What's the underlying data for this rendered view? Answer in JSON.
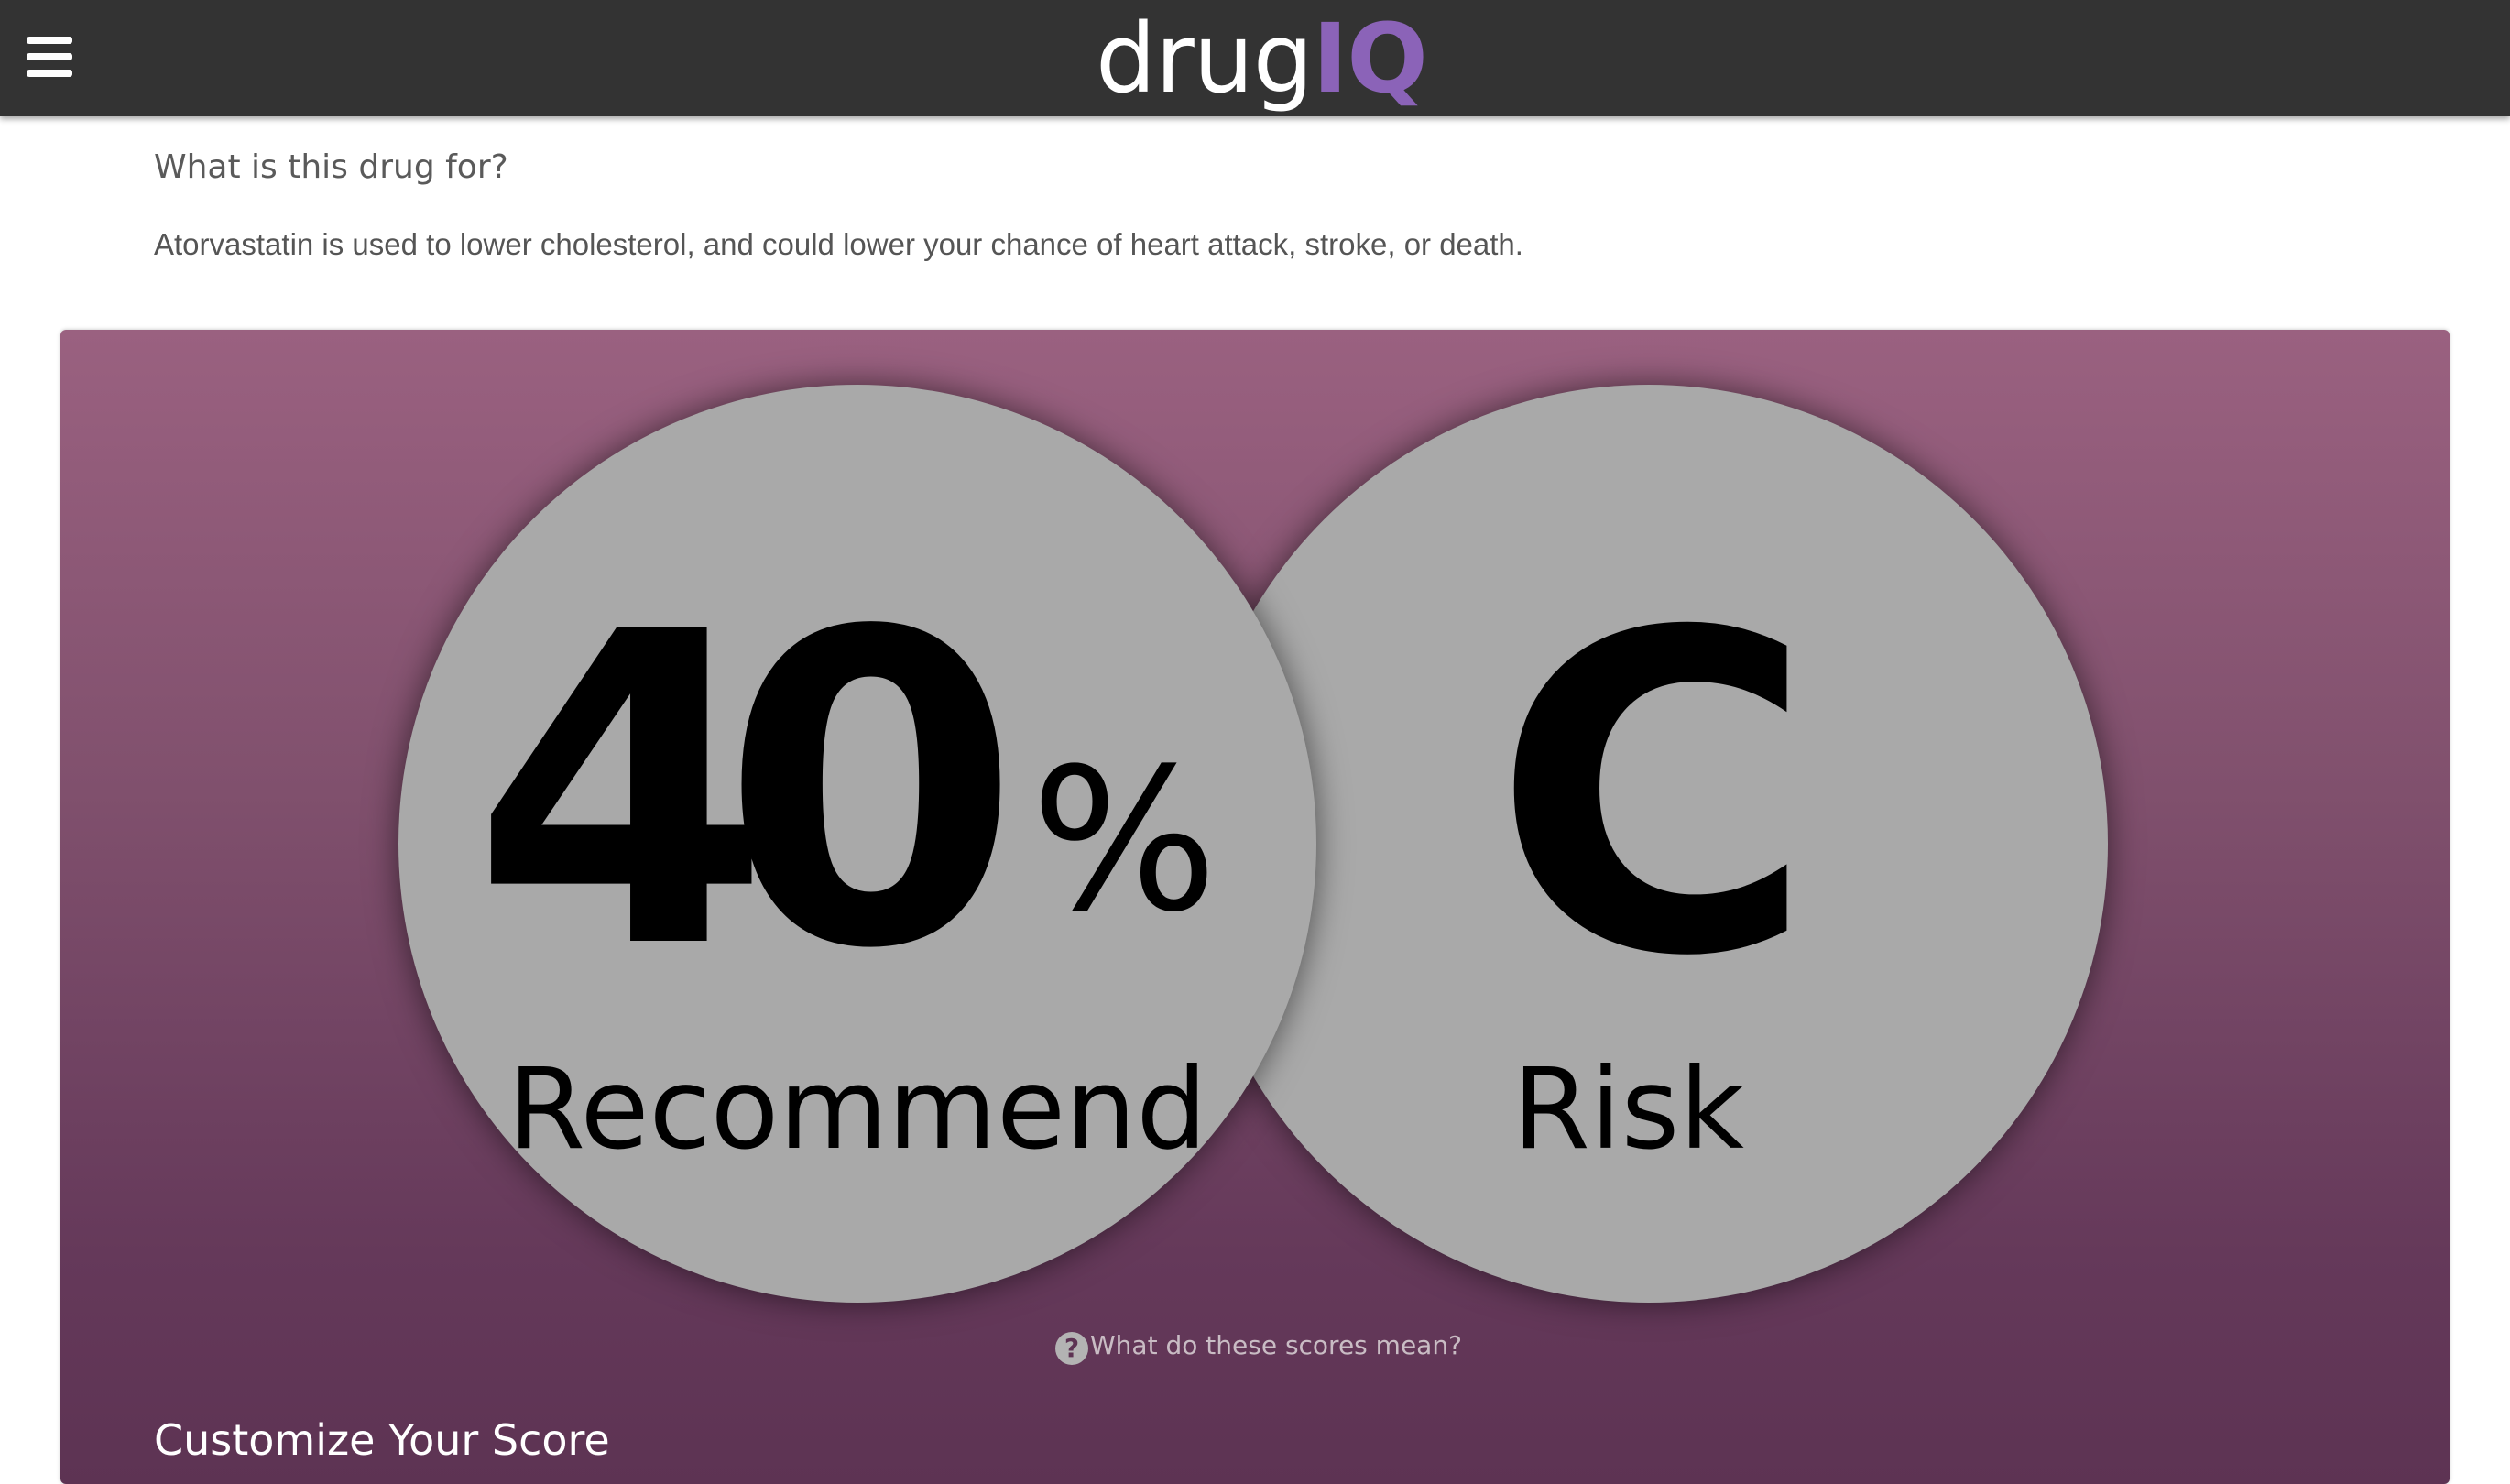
{
  "header": {
    "menu_icon": "hamburger-menu-icon",
    "logo": {
      "part1": "drug",
      "part2": "IQ"
    },
    "background_color": "#333333",
    "logo_accent_color": "#8b63b8"
  },
  "drug_info": {
    "question": "What is this drug for?",
    "answer": "Atorvastatin is used to lower cholesterol, and could lower your chance of heart attack, stroke, or death."
  },
  "scores": {
    "recommend": {
      "value": "40",
      "unit": "%",
      "label": "Recommend"
    },
    "risk": {
      "value": "C",
      "label": "Risk"
    },
    "help_icon": "question-circle-icon",
    "help_text": "What do these scores mean?",
    "panel_colors": {
      "top": "#9a6180",
      "bottom": "#5d3353"
    },
    "circle_color": "#a9a9a9"
  },
  "customize": {
    "heading": "Customize Your Score"
  }
}
